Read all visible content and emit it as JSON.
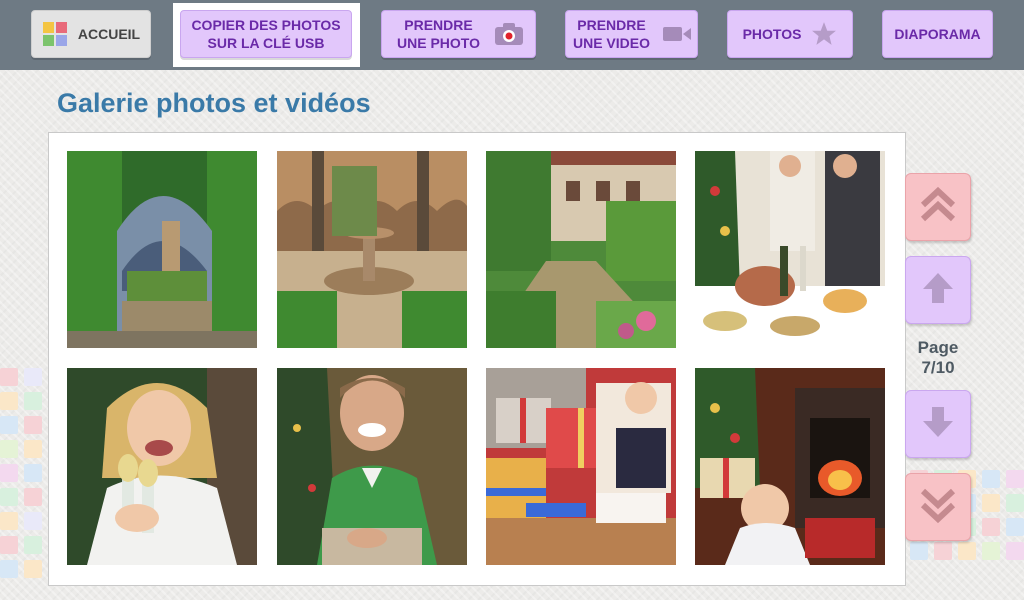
{
  "toolbar": {
    "home_label": "ACCUEIL",
    "copy_label": "COPIER DES PHOTOS SUR LA CLÉ USB",
    "photo_label": "PRENDRE UNE PHOTO",
    "video_label": "PRENDRE UNE VIDEO",
    "photos_label": "PHOTOS",
    "slideshow_label": "DIAPORAMA"
  },
  "gallery": {
    "title": "Galerie photos et vidéos",
    "thumbnails": [
      {
        "subject": "hedge-arch-garden"
      },
      {
        "subject": "courtyard-fountain"
      },
      {
        "subject": "garden-building"
      },
      {
        "subject": "christmas-dinner-table"
      },
      {
        "subject": "woman-with-champagne"
      },
      {
        "subject": "man-smiling-christmas"
      },
      {
        "subject": "child-with-gifts"
      },
      {
        "subject": "baby-by-fireplace"
      }
    ]
  },
  "pager": {
    "label": "Page",
    "value": "7/10"
  },
  "colors": {
    "toolbar_bg": "#6e7a84",
    "button_violet": "#e2c7fb",
    "button_pink": "#f8c2c6",
    "title_blue": "#3a7aa8"
  },
  "icons": {
    "home": "tiles-icon",
    "photo": "camera-icon",
    "video": "video-camera-icon",
    "photos": "star-icon",
    "scroll": [
      "double-chevron-up-icon",
      "arrow-up-icon",
      "arrow-down-icon",
      "double-chevron-down-icon"
    ]
  }
}
